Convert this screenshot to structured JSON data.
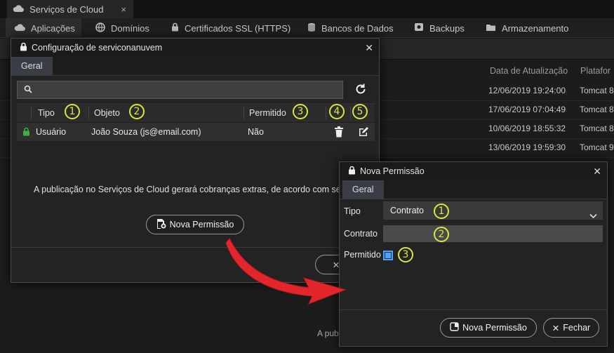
{
  "app": {
    "tab_title": "Serviços de Cloud",
    "nav": [
      "Aplicações",
      "Domínios",
      "Certificados SSL (HTTPS)",
      "Bancos de Dados",
      "Backups",
      "Armazenamento"
    ],
    "columns": [
      "Data de Atualização",
      "Platafor"
    ],
    "rows": [
      {
        "date": "12/06/2019 19:24:00",
        "platform": "Tomcat 8"
      },
      {
        "date": "17/06/2019 07:04:49",
        "platform": "Tomcat 8"
      },
      {
        "date": "10/06/2019 18:55:32",
        "platform": "Tomcat 8"
      },
      {
        "date": "13/06/2019 19:59:30",
        "platform": "Tomcat 9"
      }
    ],
    "footer_text": "A publi"
  },
  "config_modal": {
    "title": "Configuração de serviconanuvem",
    "tab": "Geral",
    "search_placeholder": "",
    "columns": {
      "tipo": "Tipo",
      "objeto": "Objeto",
      "permitido": "Permitido"
    },
    "row": {
      "tipo": "Usuário",
      "objeto": "João Souza (js@email.com)",
      "permitido": "Não"
    },
    "info_text": "A publicação no Serviços de Cloud gerará cobranças extras, de acordo com seu p",
    "new_permission_label": "Nova Permissão"
  },
  "badges": [
    "1",
    "2",
    "3",
    "4",
    "5"
  ],
  "perm_modal": {
    "title": "Nova Permissão",
    "tab": "Geral",
    "tipo_label": "Tipo",
    "tipo_value": "Contrato",
    "contrato_label": "Contrato",
    "permitido_label": "Permitido",
    "permitido_checked": true,
    "save_label": "Nova Permissão",
    "close_label": "Fechar"
  },
  "colors": {
    "accent": "#dde53c",
    "arrow": "#e3262b",
    "checkbox": "#4aa3ff",
    "lock_green": "#3cb043"
  }
}
